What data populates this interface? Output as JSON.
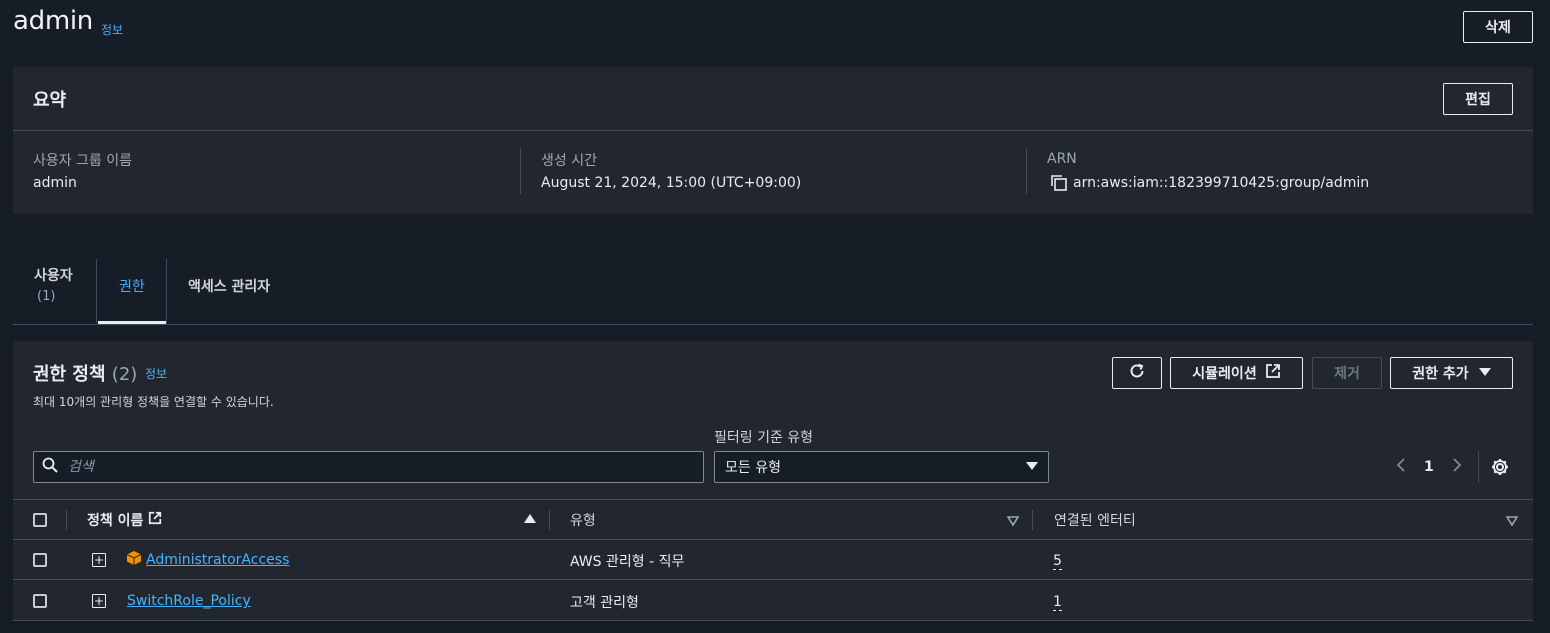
{
  "header": {
    "title": "admin",
    "info": "정보",
    "delete_label": "삭제"
  },
  "summary": {
    "title": "요약",
    "edit_label": "편집",
    "group_name_label": "사용자 그룹 이름",
    "group_name_value": "admin",
    "created_label": "생성 시간",
    "created_value": "August 21, 2024, 15:00 (UTC+09:00)",
    "arn_label": "ARN",
    "arn_value": "arn:aws:iam::182399710425:group/admin"
  },
  "tabs": [
    {
      "label": "사용자",
      "count": "(1)"
    },
    {
      "label": "권한",
      "count": ""
    },
    {
      "label": "액세스 관리자",
      "count": ""
    }
  ],
  "policies": {
    "title": "권한 정책",
    "count": "(2)",
    "info": "정보",
    "description": "최대 10개의 관리형 정책을 연결할 수 있습니다.",
    "simulate_label": "시뮬레이션",
    "remove_label": "제거",
    "add_label": "권한 추가",
    "filter_label": "필터링 기준 유형",
    "search_placeholder": "검색",
    "type_select_value": "모든 유형",
    "page": "1",
    "columns": {
      "name": "정책 이름",
      "type": "유형",
      "entities": "연결된 엔터티"
    },
    "rows": [
      {
        "name": "AdministratorAccess",
        "type": "AWS 관리형 - 직무",
        "entities": "5",
        "aws_managed": true
      },
      {
        "name": "SwitchRole_Policy",
        "type": "고객 관리형",
        "entities": "1",
        "aws_managed": false
      }
    ]
  },
  "colors": {
    "background": "#161d26",
    "panel": "#22272f",
    "link": "#42b4ff",
    "aws_icon": "#f29100"
  }
}
